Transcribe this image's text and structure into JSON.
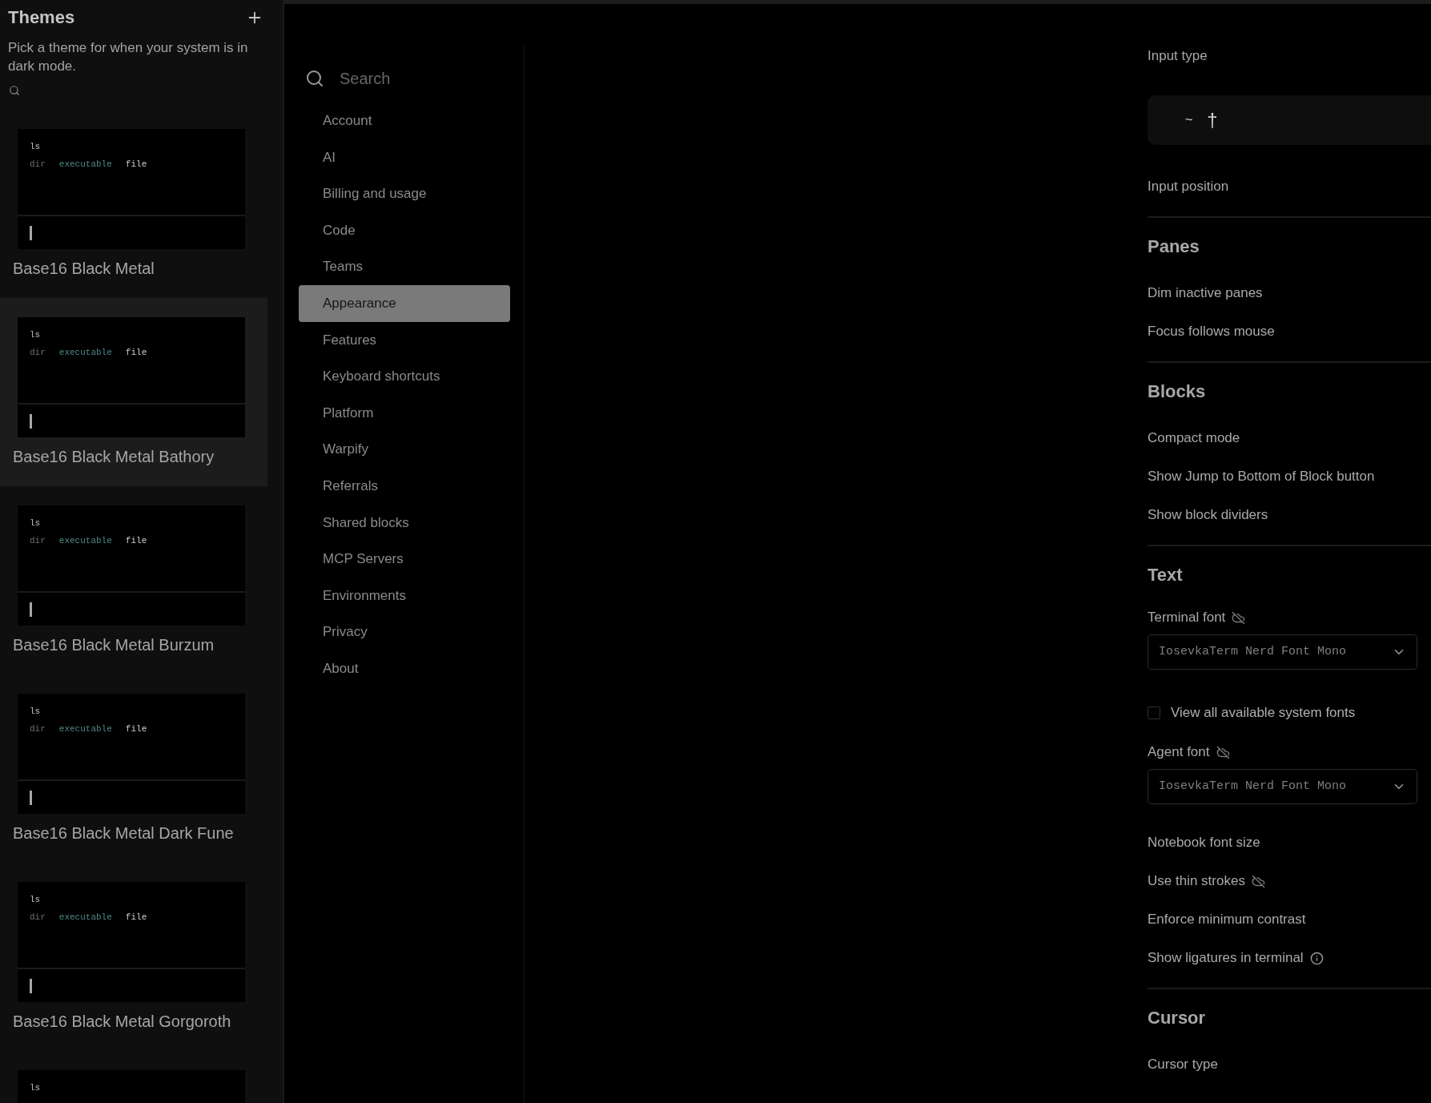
{
  "themes_panel": {
    "title": "Themes",
    "description": "Pick a theme for when your system is in dark mode.",
    "cards": [
      {
        "command": "ls",
        "output": [
          "dir",
          "executable",
          "file"
        ],
        "name": "Base16 Black Metal",
        "selected": false
      },
      {
        "command": "ls",
        "output": [
          "dir",
          "executable",
          "file"
        ],
        "name": "Base16 Black Metal Bathory",
        "selected": true
      },
      {
        "command": "ls",
        "output": [
          "dir",
          "executable",
          "file"
        ],
        "name": "Base16 Black Metal Burzum",
        "selected": false
      },
      {
        "command": "ls",
        "output": [
          "dir",
          "executable",
          "file"
        ],
        "name": "Base16 Black Metal Dark Fune",
        "selected": false
      },
      {
        "command": "ls",
        "output": [
          "dir",
          "executable",
          "file"
        ],
        "name": "Base16 Black Metal Gorgoroth",
        "selected": false
      },
      {
        "command": "ls",
        "selected": false
      }
    ]
  },
  "settings_nav": {
    "search": {
      "placeholder": "Search"
    },
    "items": [
      {
        "label": "Account",
        "selected": false
      },
      {
        "label": "AI",
        "selected": false
      },
      {
        "label": "Billing and usage",
        "selected": false
      },
      {
        "label": "Code",
        "selected": false
      },
      {
        "label": "Teams",
        "selected": false
      },
      {
        "label": "Appearance",
        "selected": true
      },
      {
        "label": "Features",
        "selected": false
      },
      {
        "label": "Keyboard shortcuts",
        "selected": false
      },
      {
        "label": "Platform",
        "selected": false
      },
      {
        "label": "Warpify",
        "selected": false
      },
      {
        "label": "Referrals",
        "selected": false
      },
      {
        "label": "Shared blocks",
        "selected": false
      },
      {
        "label": "MCP Servers",
        "selected": false
      },
      {
        "label": "Environments",
        "selected": false
      },
      {
        "label": "Privacy",
        "selected": false
      },
      {
        "label": "About",
        "selected": false
      }
    ]
  },
  "settings": {
    "sections": [
      {
        "items": [
          {
            "kind": "setting",
            "text": "Input type"
          },
          {
            "kind": "input_preview",
            "glyphs": [
              "~",
              "†"
            ]
          },
          {
            "kind": "setting",
            "text": "Input position"
          }
        ]
      },
      {
        "heading": "Panes",
        "items": [
          {
            "kind": "setting",
            "text": "Dim inactive panes"
          },
          {
            "kind": "setting",
            "text": "Focus follows mouse"
          }
        ]
      },
      {
        "heading": "Blocks",
        "items": [
          {
            "kind": "setting",
            "text": "Compact mode"
          },
          {
            "kind": "setting",
            "text": "Show Jump to Bottom of Block button"
          },
          {
            "kind": "setting",
            "text": "Show block dividers"
          }
        ]
      },
      {
        "heading": "Text",
        "items": [
          {
            "kind": "field_label",
            "text": "Terminal font",
            "sync_disabled": true
          },
          {
            "kind": "dropdown",
            "value": "IosevkaTerm Nerd Font Mono"
          },
          {
            "kind": "checkbox",
            "text": "View all available system fonts",
            "checked": false
          },
          {
            "kind": "field_label",
            "text": "Agent font",
            "sync_disabled": true
          },
          {
            "kind": "dropdown",
            "value": "IosevkaTerm Nerd Font Mono"
          },
          {
            "kind": "setting",
            "text": "Notebook font size"
          },
          {
            "kind": "setting",
            "text": "Use thin strokes",
            "sync_disabled": true
          },
          {
            "kind": "setting",
            "text": "Enforce minimum contrast"
          },
          {
            "kind": "setting",
            "text": "Show ligatures in terminal",
            "info": true
          }
        ]
      },
      {
        "heading": "Cursor",
        "items": [
          {
            "kind": "setting",
            "text": "Cursor type"
          }
        ]
      }
    ]
  }
}
